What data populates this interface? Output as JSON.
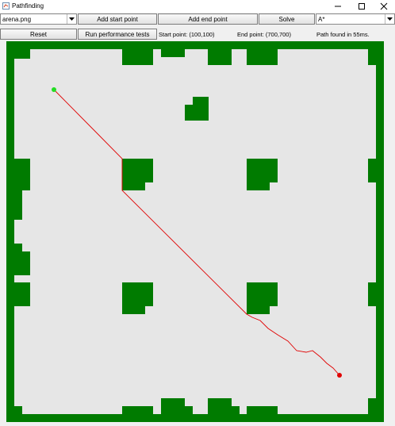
{
  "window": {
    "title": "Pathfinding"
  },
  "toolbar": {
    "map_select": "arena.png",
    "add_start_label": "Add start point",
    "add_end_label": "Add end point",
    "solve_label": "Solve",
    "algorithm_select": "A*",
    "reset_label": "Reset",
    "perf_label": "Run performance tests",
    "start_point_text": "Start point: (100,100)",
    "end_point_text": "End point: (700,700)",
    "status_text": "Path found in 55ms."
  },
  "map": {
    "wall_color": "#007b00",
    "floor_color": "#e6e6e6",
    "path_color": "#e00000",
    "start_color": "#22dd22",
    "end_color": "#e00000"
  }
}
